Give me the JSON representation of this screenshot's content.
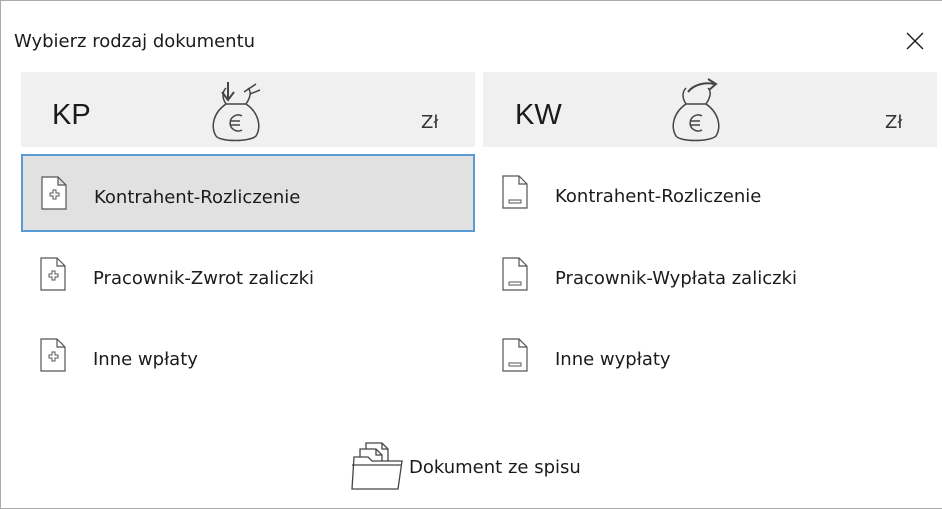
{
  "window": {
    "title": "Wybierz rodzaj dokumentu",
    "close_icon": "close-icon"
  },
  "kp": {
    "code": "KP",
    "currency": "Zł",
    "icon": "money-bag-in-icon",
    "items": [
      {
        "label": "Kontrahent-Rozliczenie",
        "icon": "document-plus-icon",
        "selected": true
      },
      {
        "label": "Pracownik-Zwrot zaliczki",
        "icon": "document-plus-icon",
        "selected": false
      },
      {
        "label": "Inne wpłaty",
        "icon": "document-plus-icon",
        "selected": false
      }
    ]
  },
  "kw": {
    "code": "KW",
    "currency": "Zł",
    "icon": "money-bag-out-icon",
    "items": [
      {
        "label": "Kontrahent-Rozliczenie",
        "icon": "document-minus-icon",
        "selected": false
      },
      {
        "label": "Pracownik-Wypłata zaliczki",
        "icon": "document-minus-icon",
        "selected": false
      },
      {
        "label": "Inne wypłaty",
        "icon": "document-minus-icon",
        "selected": false
      }
    ]
  },
  "footer": {
    "label": "Dokument ze spisu",
    "icon": "documents-folder-icon"
  },
  "colors": {
    "header_bg": "#f0f0f0",
    "selected_bg": "#e1e1e1",
    "selected_border": "#5b9bd5"
  }
}
